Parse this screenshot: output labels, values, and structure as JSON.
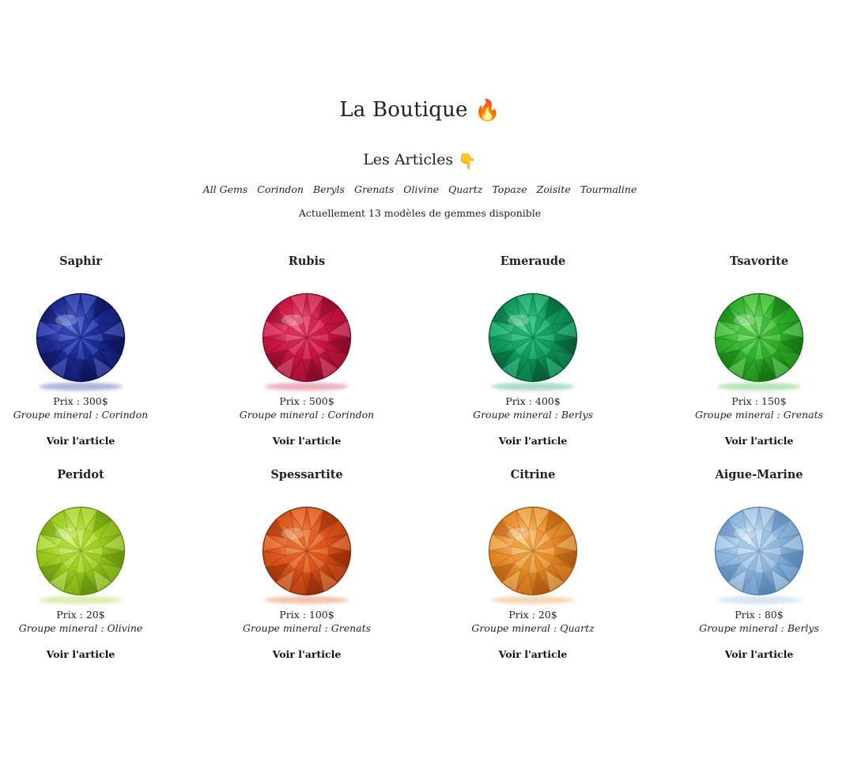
{
  "header": {
    "title": "La Boutique",
    "title_emoji": "🔥",
    "subtitle": "Les Articles",
    "subtitle_emoji": "👇"
  },
  "filters": [
    "All Gems",
    "Corindon",
    "Beryls",
    "Grenats",
    "Olivine",
    "Quartz",
    "Topaze",
    "Zoisite",
    "Tourmaline"
  ],
  "count_text": "Actuellement 13 modèles de gemmes disponible",
  "view_label": "Voir l'article",
  "products": [
    {
      "name": "Saphir",
      "price": "Prix : 300$",
      "group": "Groupe mineral : Corindon",
      "color": "#1b2a8f",
      "dark": "#0b1150",
      "light": "#5f74e0"
    },
    {
      "name": "Rubis",
      "price": "Prix : 500$",
      "group": "Groupe mineral : Corindon",
      "color": "#c8163f",
      "dark": "#7a0a25",
      "light": "#f26a8a"
    },
    {
      "name": "Emeraude",
      "price": "Prix : 400$",
      "group": "Groupe mineral : Berlys",
      "color": "#0f9a5a",
      "dark": "#055433",
      "light": "#4fd39a"
    },
    {
      "name": "Tsavorite",
      "price": "Prix : 150$",
      "group": "Groupe mineral : Grenats",
      "color": "#2fb02a",
      "dark": "#136b12",
      "light": "#8ae67f"
    },
    {
      "name": "Peridot",
      "price": "Prix : 20$",
      "group": "Groupe mineral : Olivine",
      "color": "#9ccc1f",
      "dark": "#5f8a0c",
      "light": "#d8f27a"
    },
    {
      "name": "Spessartite",
      "price": "Prix : 100$",
      "group": "Groupe mineral : Grenats",
      "color": "#d9541a",
      "dark": "#8a2a08",
      "light": "#f59a5f"
    },
    {
      "name": "Citrine",
      "price": "Prix : 20$",
      "group": "Groupe mineral : Quartz",
      "color": "#e68c2a",
      "dark": "#a65510",
      "light": "#fbd08a"
    },
    {
      "name": "Aigue-Marine",
      "price": "Prix : 80$",
      "group": "Groupe mineral : Berlys",
      "color": "#8fb6dc",
      "dark": "#4f7fae",
      "light": "#dbeaf7"
    }
  ]
}
